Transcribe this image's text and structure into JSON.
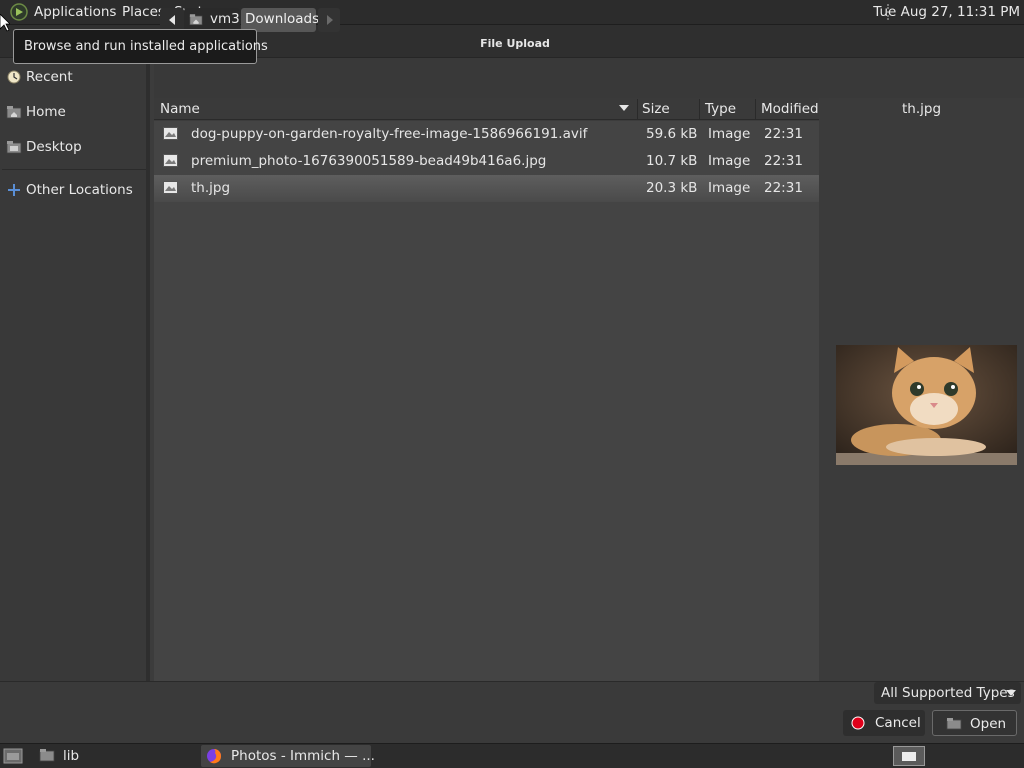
{
  "top_panel": {
    "menus": [
      "Applications",
      "Places",
      "System"
    ],
    "clock": "Tue Aug 27, 11:31 PM"
  },
  "tooltip": "Browse and run installed applications",
  "dialog": {
    "title": "File Upload"
  },
  "sidebar": {
    "items": [
      {
        "label": "Recent",
        "icon": "clock-icon"
      },
      {
        "label": "Home",
        "icon": "home-folder-icon"
      },
      {
        "label": "Desktop",
        "icon": "desktop-folder-icon"
      },
      {
        "label": "Other Locations",
        "icon": "plus-icon"
      }
    ]
  },
  "pathbar": {
    "crumbs": [
      "vm3",
      "Downloads"
    ]
  },
  "columns": {
    "name": "Name",
    "size": "Size",
    "type": "Type",
    "modified": "Modified"
  },
  "files": [
    {
      "name": "dog-puppy-on-garden-royalty-free-image-1586966191.avif",
      "size": "59.6 kB",
      "type": "Image",
      "modified": "22:31",
      "selected": false
    },
    {
      "name": "premium_photo-1676390051589-bead49b416a6.jpg",
      "size": "10.7 kB",
      "type": "Image",
      "modified": "22:31",
      "selected": false
    },
    {
      "name": "th.jpg",
      "size": "20.3 kB",
      "type": "Image",
      "modified": "22:31",
      "selected": true
    }
  ],
  "preview": {
    "name": "th.jpg"
  },
  "filter": {
    "selected": "All Supported Types"
  },
  "buttons": {
    "cancel": "Cancel",
    "open": "Open"
  },
  "taskbar": {
    "items": [
      "lib",
      "Photos - Immich — ..."
    ]
  },
  "colors": {
    "selected_row": "#555555",
    "cancel_icon": "#e0001a"
  }
}
